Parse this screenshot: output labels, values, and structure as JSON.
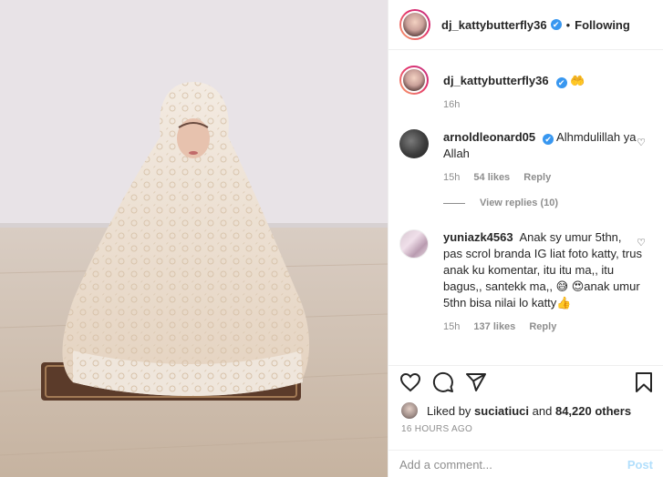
{
  "header": {
    "username": "dj_kattybutterfly36",
    "verified_mark": "✔",
    "separator": "•",
    "follow_status": "Following"
  },
  "caption": {
    "username": "dj_kattybutterfly36",
    "emoji": "🤲",
    "time": "16h"
  },
  "comments": [
    {
      "username": "arnoldleonard05",
      "text": "Alhmdulillah ya Allah",
      "time": "15h",
      "likes": "54 likes",
      "reply": "Reply"
    },
    {
      "username": "yuniazk4563",
      "text": "Anak sy umur 5thn, pas scrol branda IG liat foto katty, trus anak ku komentar, itu itu ma,, itu bagus,, santekk ma,, 😅 😍anak umur 5thn bisa nilai lo katty👍",
      "time": "15h",
      "likes": "137 likes",
      "reply": "Reply"
    }
  ],
  "view_replies": "View replies (10)",
  "liked_by": {
    "prefix": "Liked by",
    "user": "suciatiuci",
    "connector": "and",
    "others": "84,220 others"
  },
  "timestamp": "16 HOURS AGO",
  "add_comment": {
    "placeholder": "Add a comment...",
    "post_label": "Post"
  },
  "icons": {
    "like": "heart-icon",
    "comment": "comment-icon",
    "share": "share-icon",
    "save": "bookmark-icon"
  },
  "colors": {
    "verified": "#3897f0",
    "post_disabled": "#b2dffc",
    "muted": "#8e8e8e"
  }
}
